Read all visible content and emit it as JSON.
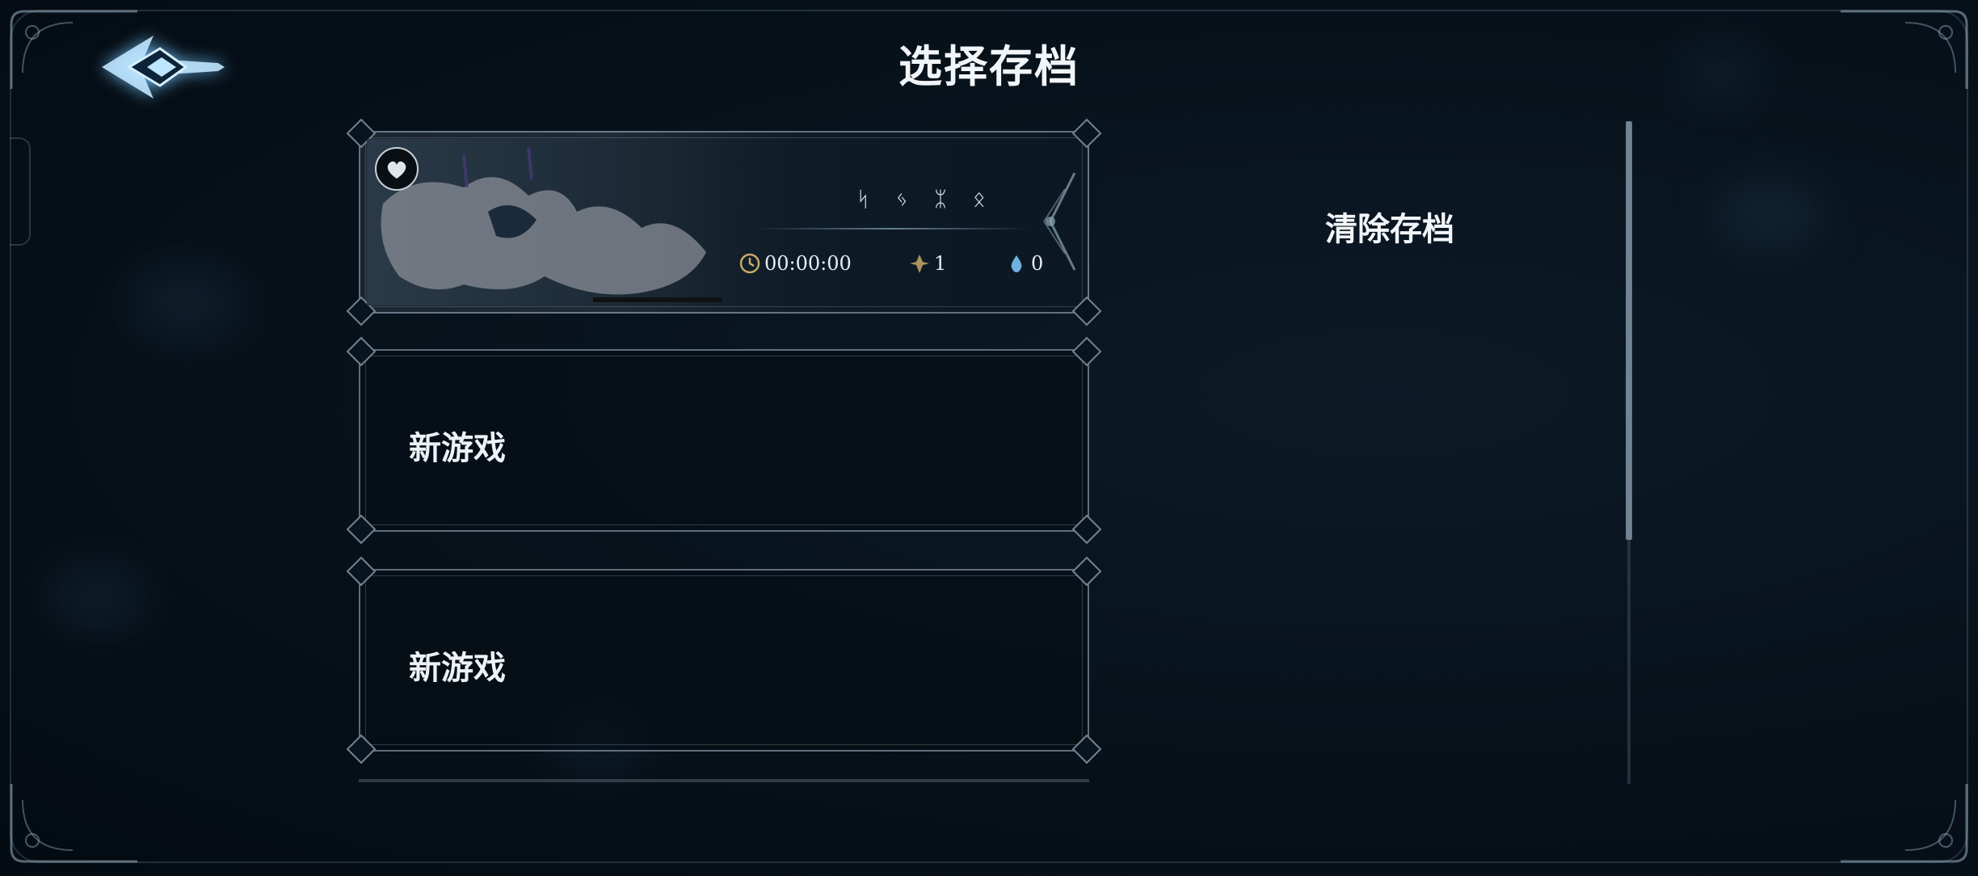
{
  "header": {
    "title": "选择存档"
  },
  "back_button": {
    "icon": "back-arrow-icon"
  },
  "save_slots": [
    {
      "type": "existing",
      "badge_icon": "heart-badge-icon",
      "runes": "ᛋ ᛃ ᛯ ᛟ",
      "playtime": "00:00:00",
      "level": "1",
      "essence": "0"
    },
    {
      "type": "new",
      "label": "新游戏"
    },
    {
      "type": "new",
      "label": "新游戏"
    }
  ],
  "actions": {
    "clear_save_label": "清除存档"
  },
  "colors": {
    "accent_glow": "#7cc8ff",
    "frame": "#aabecd",
    "background": "#07111a",
    "gold_icon": "#c9a86a",
    "water_icon": "#6fb2e0"
  }
}
